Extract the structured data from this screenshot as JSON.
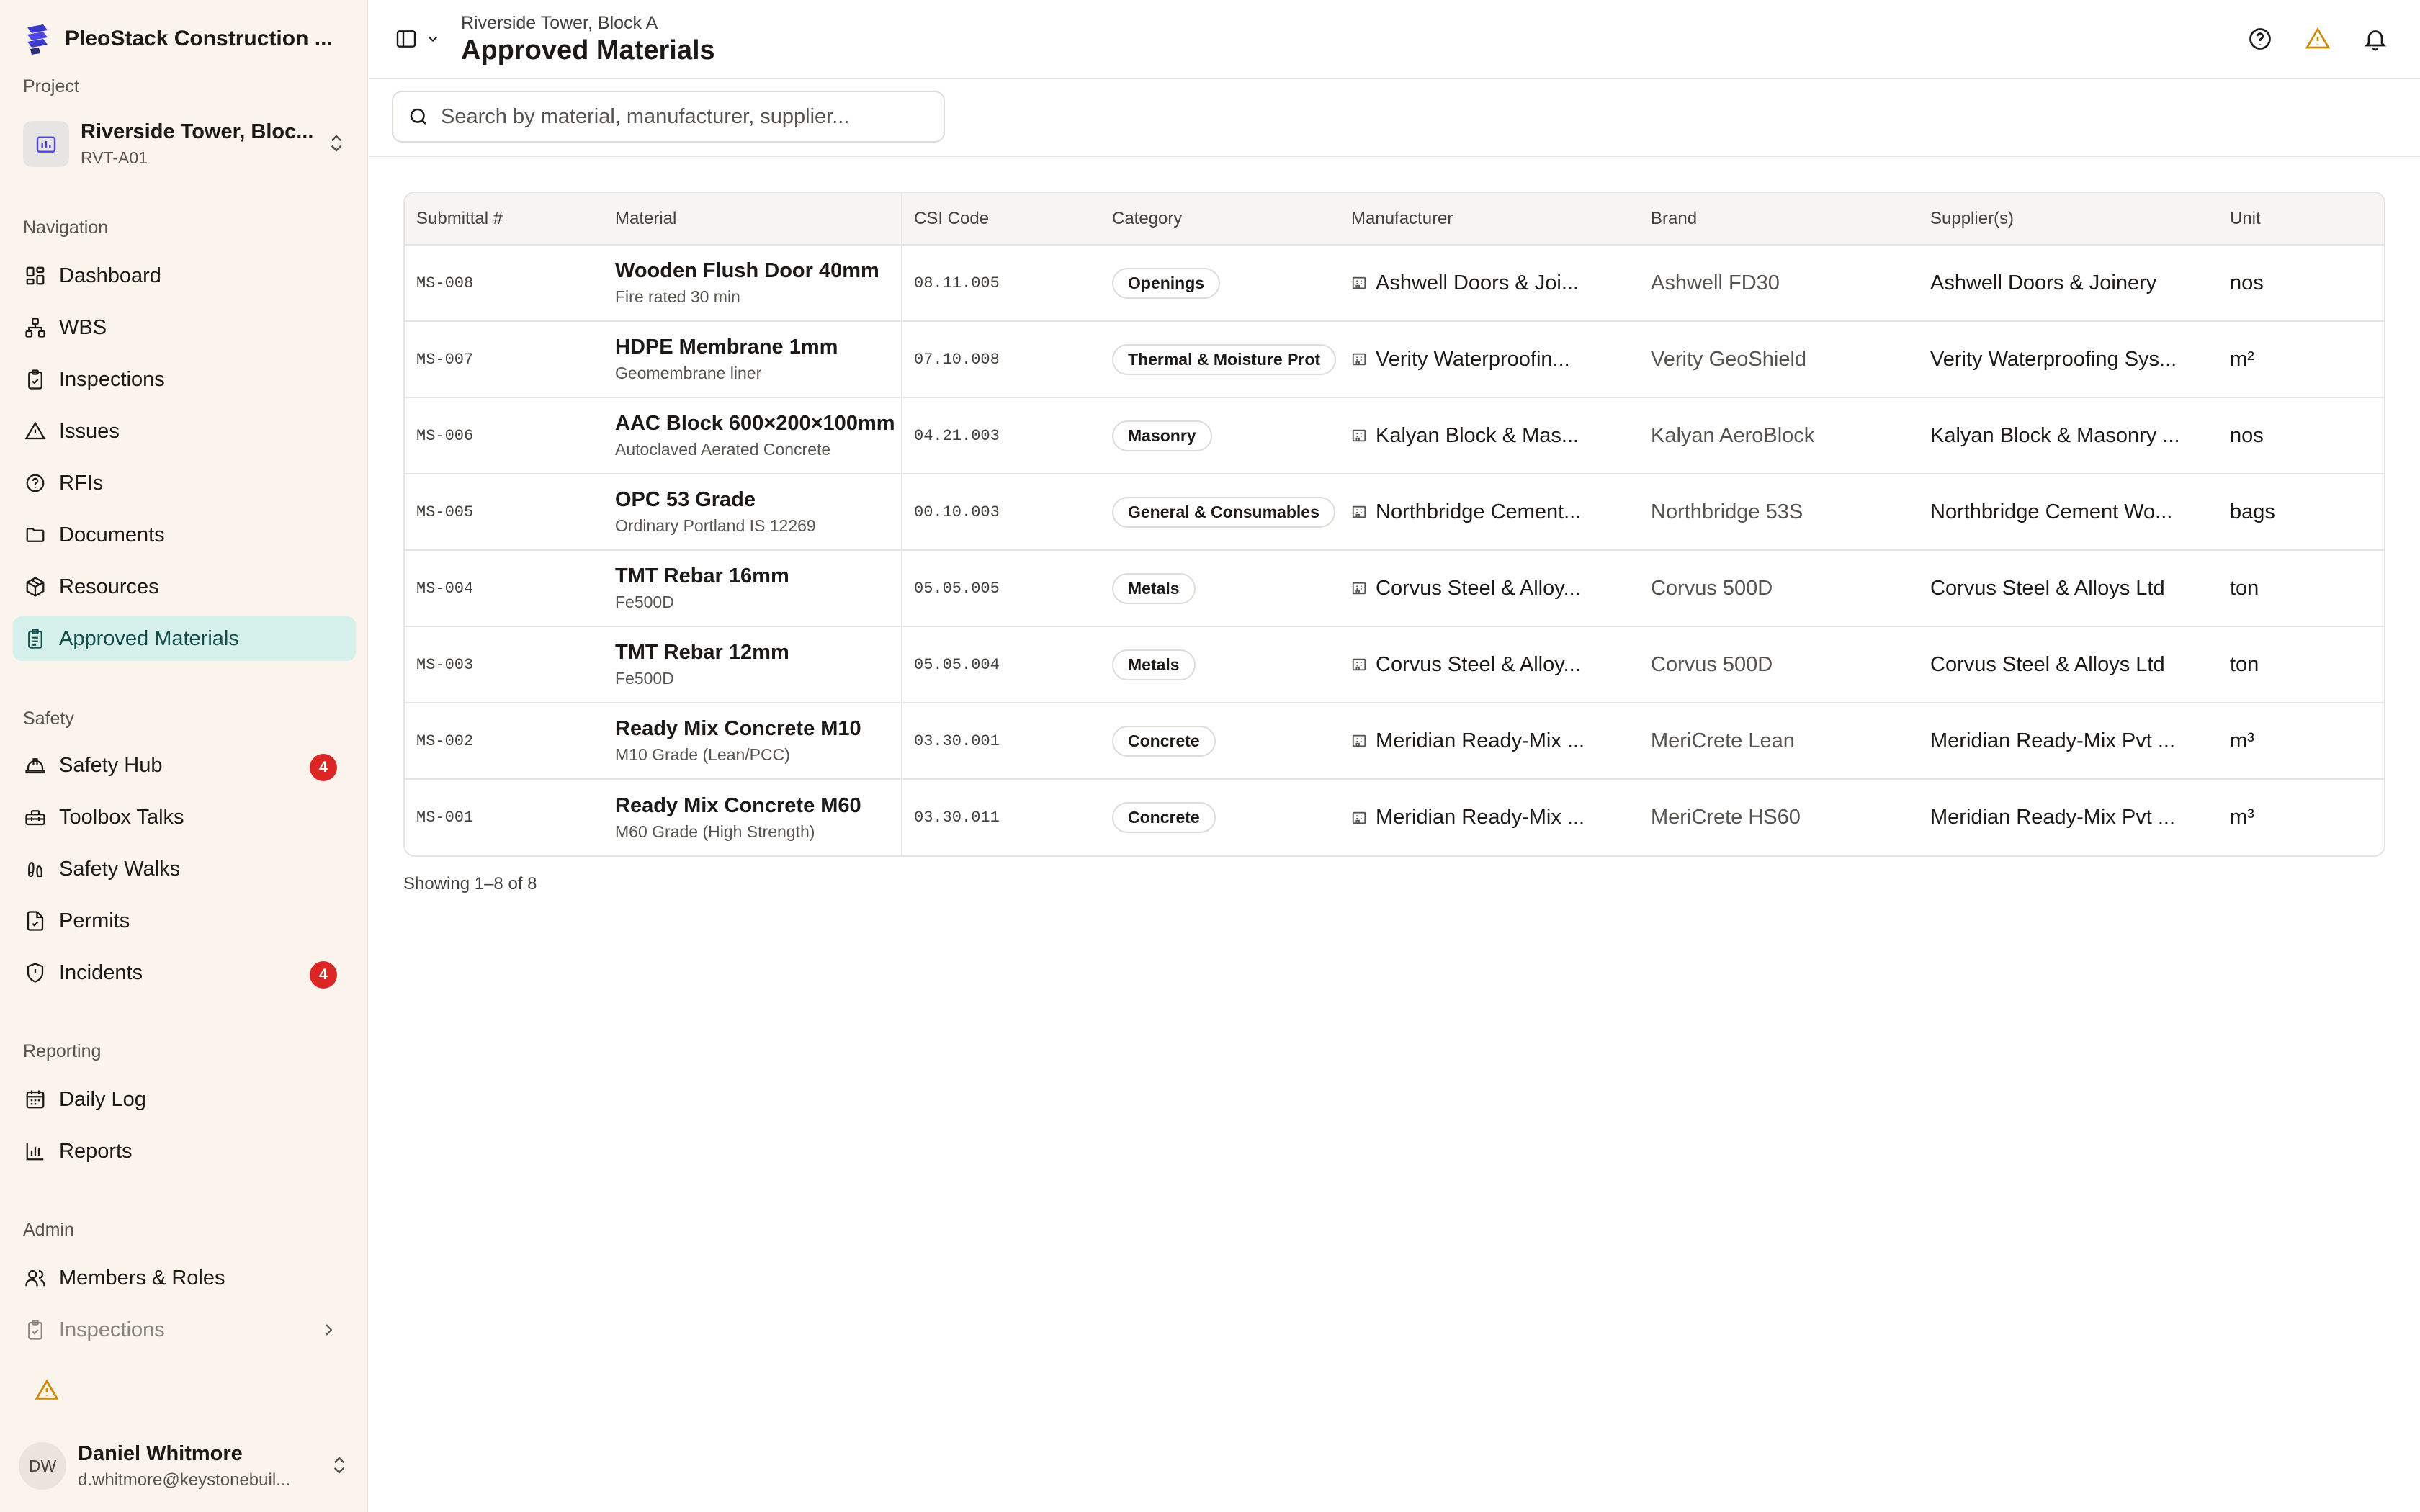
{
  "app": {
    "name": "PleoStack Construction ..."
  },
  "project": {
    "section_label": "Project",
    "name": "Riverside Tower, Bloc...",
    "code": "RVT-A01"
  },
  "sidebar": {
    "navigation": {
      "label": "Navigation",
      "items": [
        {
          "label": "Dashboard",
          "icon": "dashboard-icon"
        },
        {
          "label": "WBS",
          "icon": "hierarchy-icon"
        },
        {
          "label": "Inspections",
          "icon": "clipboard-check-icon"
        },
        {
          "label": "Issues",
          "icon": "warning-icon"
        },
        {
          "label": "RFIs",
          "icon": "help-circle-icon"
        },
        {
          "label": "Documents",
          "icon": "folder-icon"
        },
        {
          "label": "Resources",
          "icon": "package-icon"
        },
        {
          "label": "Approved Materials",
          "icon": "clipboard-list-icon",
          "active": true
        }
      ]
    },
    "safety": {
      "label": "Safety",
      "items": [
        {
          "label": "Safety Hub",
          "icon": "hard-hat-icon",
          "badge": "4"
        },
        {
          "label": "Toolbox Talks",
          "icon": "toolbox-icon"
        },
        {
          "label": "Safety Walks",
          "icon": "footprints-icon"
        },
        {
          "label": "Permits",
          "icon": "file-check-icon"
        },
        {
          "label": "Incidents",
          "icon": "shield-alert-icon",
          "badge": "4"
        }
      ]
    },
    "reporting": {
      "label": "Reporting",
      "items": [
        {
          "label": "Daily Log",
          "icon": "calendar-icon"
        },
        {
          "label": "Reports",
          "icon": "bar-chart-icon"
        }
      ]
    },
    "admin": {
      "label": "Admin",
      "items": [
        {
          "label": "Members & Roles",
          "icon": "users-icon"
        },
        {
          "label": "Inspections",
          "icon": "clipboard-check-icon"
        }
      ]
    }
  },
  "user": {
    "initials": "DW",
    "name": "Daniel Whitmore",
    "email": "d.whitmore@keystonebuil..."
  },
  "header": {
    "breadcrumb": "Riverside Tower, Block A",
    "title": "Approved Materials"
  },
  "search": {
    "placeholder": "Search by material, manufacturer, supplier..."
  },
  "table": {
    "columns": [
      "Submittal #",
      "Material",
      "CSI Code",
      "Category",
      "Manufacturer",
      "Brand",
      "Supplier(s)",
      "Unit"
    ],
    "rows": [
      {
        "submittal": "MS-008",
        "material": "Wooden Flush Door 40mm",
        "description": "Fire rated 30 min",
        "csi": "08.11.005",
        "category": "Openings",
        "manufacturer": "Ashwell Doors & Joi...",
        "brand": "Ashwell FD30",
        "supplier": "Ashwell Doors & Joinery",
        "unit": "nos"
      },
      {
        "submittal": "MS-007",
        "material": "HDPE Membrane 1mm",
        "description": "Geomembrane liner",
        "csi": "07.10.008",
        "category": "Thermal & Moisture Prot",
        "manufacturer": "Verity Waterproofin...",
        "brand": "Verity GeoShield",
        "supplier": "Verity Waterproofing Sys...",
        "unit": "m²"
      },
      {
        "submittal": "MS-006",
        "material": "AAC Block 600×200×100mm",
        "description": "Autoclaved Aerated Concrete",
        "csi": "04.21.003",
        "category": "Masonry",
        "manufacturer": "Kalyan Block & Mas...",
        "brand": "Kalyan AeroBlock",
        "supplier": "Kalyan Block & Masonry ...",
        "unit": "nos"
      },
      {
        "submittal": "MS-005",
        "material": "OPC 53 Grade",
        "description": "Ordinary Portland IS 12269",
        "csi": "00.10.003",
        "category": "General & Consumables",
        "manufacturer": "Northbridge Cement...",
        "brand": "Northbridge 53S",
        "supplier": "Northbridge Cement Wo...",
        "unit": "bags"
      },
      {
        "submittal": "MS-004",
        "material": "TMT Rebar 16mm",
        "description": "Fe500D",
        "csi": "05.05.005",
        "category": "Metals",
        "manufacturer": "Corvus Steel & Alloy...",
        "brand": "Corvus 500D",
        "supplier": "Corvus Steel & Alloys Ltd",
        "unit": "ton"
      },
      {
        "submittal": "MS-003",
        "material": "TMT Rebar 12mm",
        "description": "Fe500D",
        "csi": "05.05.004",
        "category": "Metals",
        "manufacturer": "Corvus Steel & Alloy...",
        "brand": "Corvus 500D",
        "supplier": "Corvus Steel & Alloys Ltd",
        "unit": "ton"
      },
      {
        "submittal": "MS-002",
        "material": "Ready Mix Concrete M10",
        "description": "M10 Grade (Lean/PCC)",
        "csi": "03.30.001",
        "category": "Concrete",
        "manufacturer": "Meridian Ready-Mix ...",
        "brand": "MeriCrete Lean",
        "supplier": "Meridian Ready-Mix Pvt ...",
        "unit": "m³"
      },
      {
        "submittal": "MS-001",
        "material": "Ready Mix Concrete M60",
        "description": "M60 Grade (High Strength)",
        "csi": "03.30.011",
        "category": "Concrete",
        "manufacturer": "Meridian Ready-Mix ...",
        "brand": "MeriCrete HS60",
        "supplier": "Meridian Ready-Mix Pvt ...",
        "unit": "m³"
      }
    ]
  },
  "pagination": {
    "summary": "Showing 1–8 of 8"
  },
  "colors": {
    "accent_active_bg": "#d5efeb",
    "badge": "#dc2626",
    "warning": "#eab308",
    "sidebar_bg": "#fbf4ec"
  }
}
